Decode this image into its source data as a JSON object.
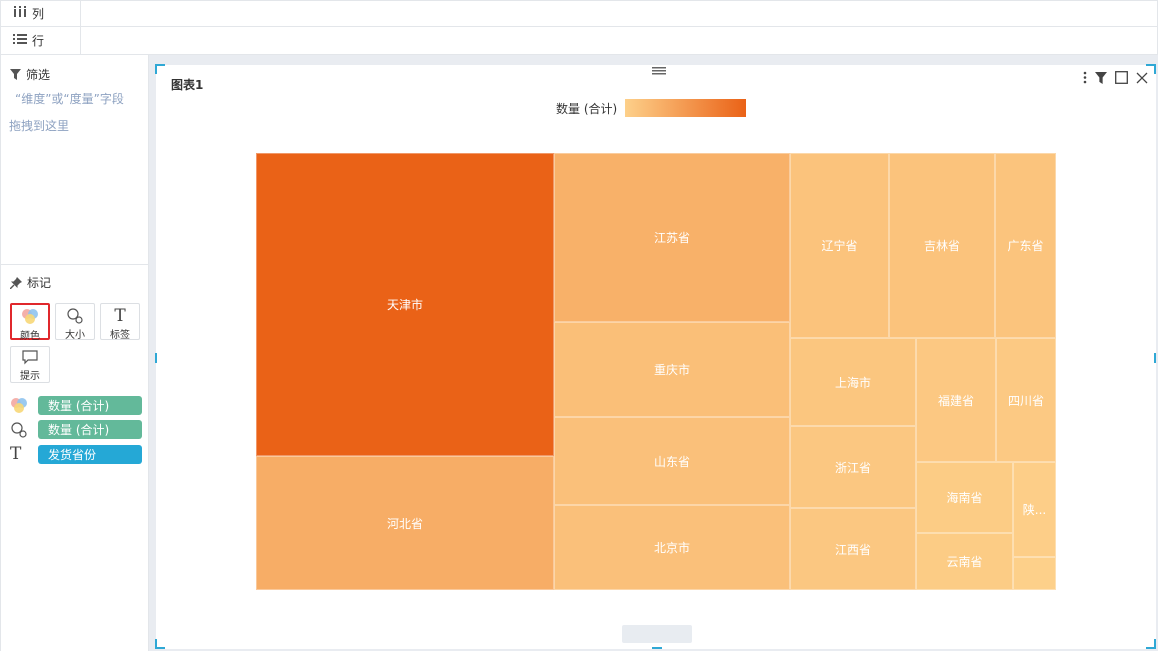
{
  "shelves": {
    "columns_label": "列",
    "rows_label": "行"
  },
  "filter": {
    "title": "筛选",
    "hint": "“维度”或“度量”字段",
    "drag_hint": "拖拽到这里"
  },
  "marks": {
    "title": "标记",
    "buttons": {
      "color": "颜色",
      "size": "大小",
      "label": "标签",
      "tooltip": "提示"
    },
    "pills": [
      {
        "text": "数量 (合计)",
        "channel": "color"
      },
      {
        "text": "数量 (合计)",
        "channel": "size"
      },
      {
        "text": "发货省份",
        "channel": "label"
      }
    ]
  },
  "chart": {
    "title": "图表1",
    "legend_title": "数量 (合计)"
  },
  "colors": {
    "low": "#fdd08a",
    "high": "#ea6217",
    "dimension_pill": "#25a8d6",
    "measure_pill": "#63b99a"
  },
  "chart_data": {
    "type": "treemap",
    "color_by": "数量 (合计)",
    "labels": [
      "天津市",
      "河北省",
      "江苏省",
      "重庆市",
      "山东省",
      "北京市",
      "辽宁省",
      "吉林省",
      "广东省",
      "上海市",
      "福建省",
      "四川省",
      "浙江省",
      "海南省",
      "陕...",
      "江西省",
      "云南省"
    ],
    "items": [
      {
        "label": "天津市",
        "value": 100
      },
      {
        "label": "河北省",
        "value": 33
      },
      {
        "label": "江苏省",
        "value": 30
      },
      {
        "label": "重庆市",
        "value": 17
      },
      {
        "label": "山东省",
        "value": 16
      },
      {
        "label": "北京市",
        "value": 16
      },
      {
        "label": "辽宁省",
        "value": 14
      },
      {
        "label": "吉林省",
        "value": 14
      },
      {
        "label": "广东省",
        "value": 13
      },
      {
        "label": "上海市",
        "value": 11
      },
      {
        "label": "福建省",
        "value": 9
      },
      {
        "label": "四川省",
        "value": 8
      },
      {
        "label": "浙江省",
        "value": 10
      },
      {
        "label": "海南省",
        "value": 6
      },
      {
        "label": "陕...",
        "value": 4
      },
      {
        "label": "江西省",
        "value": 10
      },
      {
        "label": "云南省",
        "value": 6
      },
      {
        "label": "",
        "value": 2
      }
    ]
  }
}
